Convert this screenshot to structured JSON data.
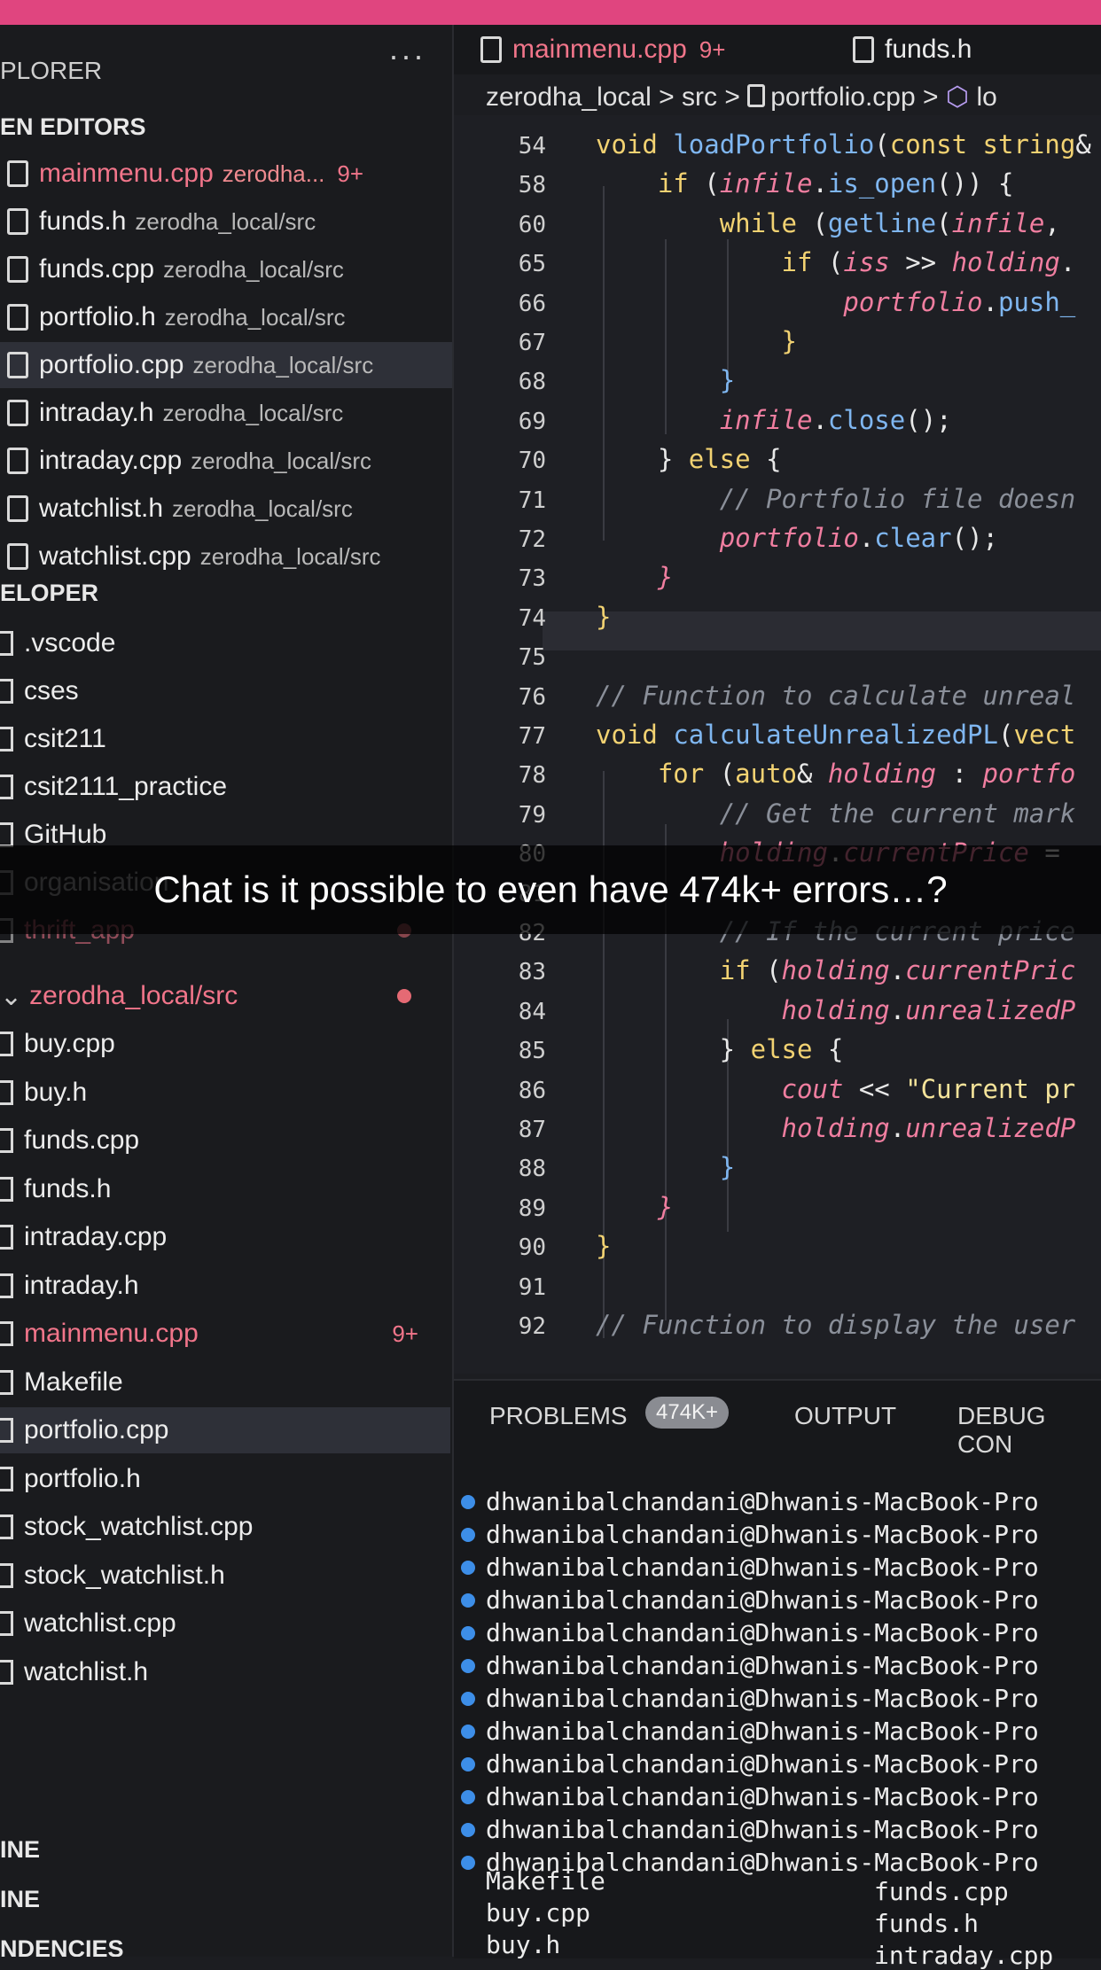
{
  "sidebar": {
    "header": "PLORER",
    "more": "···",
    "open_editors_title": "EN EDITORS",
    "open_editors": [
      {
        "name": "mainmenu.cpp",
        "path": "zerodha...",
        "badge": "9+",
        "modified": true
      },
      {
        "name": "funds.h",
        "path": "zerodha_local/src"
      },
      {
        "name": "funds.cpp",
        "path": "zerodha_local/src"
      },
      {
        "name": "portfolio.h",
        "path": "zerodha_local/src"
      },
      {
        "name": "portfolio.cpp",
        "path": "zerodha_local/src",
        "selected": true
      },
      {
        "name": "intraday.h",
        "path": "zerodha_local/src"
      },
      {
        "name": "intraday.cpp",
        "path": "zerodha_local/src"
      },
      {
        "name": "watchlist.h",
        "path": "zerodha_local/src"
      },
      {
        "name": "watchlist.cpp",
        "path": "zerodha_local/src"
      }
    ],
    "workspace_title": "ELOPER",
    "folders": [
      ".vscode",
      "cses",
      "csit211",
      "csit2111_practice",
      "GitHub",
      "organisation",
      "thrift_app"
    ],
    "project_folder": "zerodha_local/src",
    "project_files": [
      {
        "name": "buy.cpp"
      },
      {
        "name": "buy.h"
      },
      {
        "name": "funds.cpp"
      },
      {
        "name": "funds.h"
      },
      {
        "name": "intraday.cpp"
      },
      {
        "name": "intraday.h"
      },
      {
        "name": "mainmenu.cpp",
        "badge": "9+",
        "modified": true
      },
      {
        "name": "Makefile"
      },
      {
        "name": "portfolio.cpp",
        "selected": true
      },
      {
        "name": "portfolio.h"
      },
      {
        "name": "stock_watchlist.cpp"
      },
      {
        "name": "stock_watchlist.h"
      },
      {
        "name": "watchlist.cpp"
      },
      {
        "name": "watchlist.h"
      }
    ],
    "bottom_sections": [
      "INE",
      "INE",
      "NDENCIES"
    ]
  },
  "tabs": [
    {
      "label": "mainmenu.cpp",
      "badge": "9+",
      "modified": true
    },
    {
      "label": "funds.h"
    }
  ],
  "breadcrumb": {
    "folder": "zerodha_local",
    "sep": ">",
    "src": "src",
    "file": "portfolio.cpp",
    "symbol": "lo"
  },
  "code_lines": [
    {
      "n": "54",
      "html": "<span class='kw'>void</span> <span class='fn'>loadPortfolio</span>(<span class='kw'>const</span> <span class='ty'>string</span>&amp;"
    },
    {
      "n": "58",
      "html": "    <span class='kw'>if</span> (<span class='it'>infile</span>.<span class='fn'>is_open</span>()) {"
    },
    {
      "n": "60",
      "html": "        <span class='kw'>while</span> (<span class='fn'>getline</span>(<span class='it'>infile</span>, "
    },
    {
      "n": "65",
      "html": "            <span class='kw'>if</span> (<span class='it'>iss</span> &gt;&gt; <span class='it'>holding</span>."
    },
    {
      "n": "66",
      "html": "                <span class='it'>portfolio</span>.<span class='fn'>push_</span>"
    },
    {
      "n": "67",
      "html": "            <span class='kw'>}</span>"
    },
    {
      "n": "68",
      "html": "        <span class='fn'>}</span>"
    },
    {
      "n": "69",
      "html": "        <span class='it'>infile</span>.<span class='fn'>close</span>();"
    },
    {
      "n": "70",
      "html": "    } <span class='kw'>else</span> {"
    },
    {
      "n": "71",
      "html": "        <span class='cm'>// Portfolio file doesn</span>"
    },
    {
      "n": "72",
      "html": "        <span class='it'>portfolio</span>.<span class='fn'>clear</span>();"
    },
    {
      "n": "73",
      "html": "    <span class='it'>}</span>"
    },
    {
      "n": "74",
      "html": "<span class='kw'>}</span>"
    },
    {
      "n": "75",
      "html": ""
    },
    {
      "n": "76",
      "html": "<span class='cm'>// Function to calculate unreal</span>"
    },
    {
      "n": "77",
      "html": "<span class='kw'>void</span> <span class='fn'>calculateUnrealizedPL</span>(<span class='ty'>vect</span>"
    },
    {
      "n": "78",
      "html": "    <span class='kw'>for</span> (<span class='kw'>auto</span>&amp; <span class='it'>holding</span> : <span class='it'>portfo</span>"
    },
    {
      "n": "79",
      "html": "        <span class='cm'>// Get the current mark</span>"
    },
    {
      "n": "80",
      "html": "        <span class='it'>holding</span>.<span class='it'>currentPrice</span> ="
    },
    {
      "n": "81",
      "html": ""
    },
    {
      "n": "82",
      "html": "        <span class='cm'>// If the current price</span>"
    },
    {
      "n": "83",
      "html": "        <span class='kw'>if</span> (<span class='it'>holding</span>.<span class='it'>currentPric</span>"
    },
    {
      "n": "84",
      "html": "            <span class='it'>holding</span>.<span class='it'>unrealizedP</span>"
    },
    {
      "n": "85",
      "html": "        } <span class='kw'>else</span> {"
    },
    {
      "n": "86",
      "html": "            <span class='it'>cout</span> &lt;&lt; <span class='str'>\"Current pr</span>"
    },
    {
      "n": "87",
      "html": "            <span class='it'>holding</span>.<span class='it'>unrealizedP</span>"
    },
    {
      "n": "88",
      "html": "        <span class='fn'>}</span>"
    },
    {
      "n": "89",
      "html": "    <span class='it'>}</span>"
    },
    {
      "n": "90",
      "html": "<span class='kw'>}</span>"
    },
    {
      "n": "91",
      "html": ""
    },
    {
      "n": "92",
      "html": "<span class='cm'>// Function to display the user</span>"
    }
  ],
  "caption": "Chat is it possible to even have 474k+ errors…?",
  "panel": {
    "problems_label": "PROBLEMS",
    "problems_count": "474K+",
    "output_label": "OUTPUT",
    "debug_label": "DEBUG CON",
    "prompt": "dhwanibalchandani@Dhwanis-MacBook-Pro",
    "ls_col1": [
      "Makefile",
      "buy.cpp",
      "buy.h"
    ],
    "ls_col2": [
      "funds.cpp",
      "funds.h",
      "intraday.cpp"
    ]
  },
  "colors": {
    "accent_bar": "#e0457f",
    "modified": "#f1758a",
    "terminal_dot": "#3d8ee8"
  }
}
